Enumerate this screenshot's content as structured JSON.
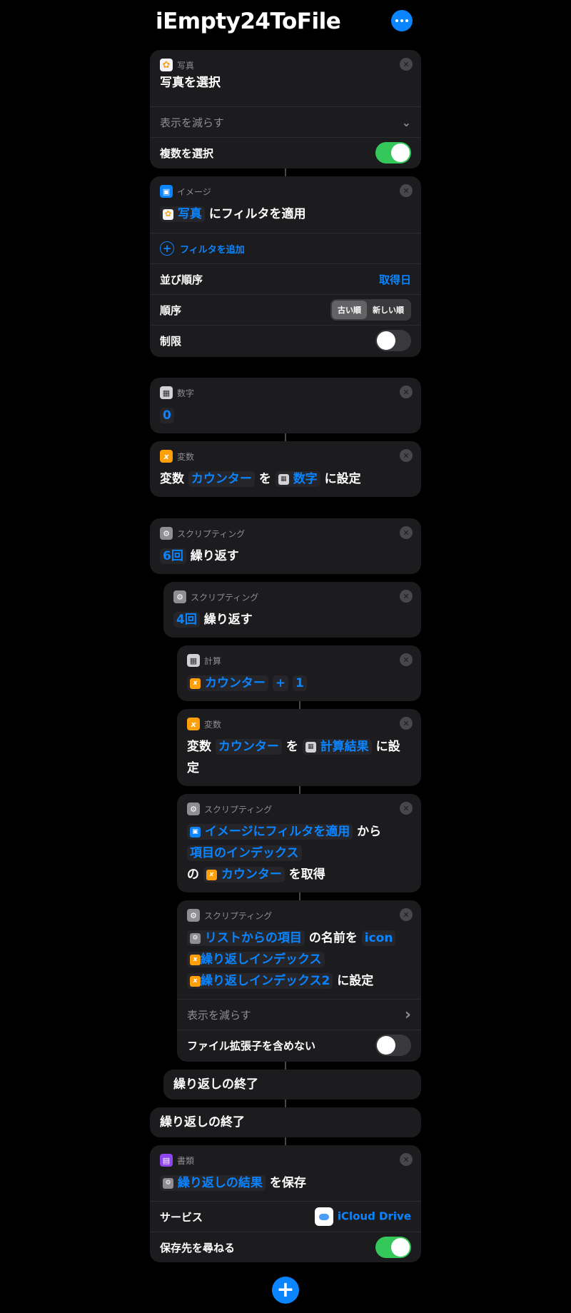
{
  "title": "iEmpty24ToFile",
  "photos_block": {
    "category": "写真",
    "main": "写真を選択",
    "show_less": "表示を減らす",
    "multi_label": "複数を選択"
  },
  "image_block": {
    "category": "イメージ",
    "token": "写真",
    "main_suffix": "にフィルタを適用",
    "add_filter": "フィルタを追加",
    "sort_label": "並び順序",
    "sort_value": "取得日",
    "order_label": "順序",
    "order_options": [
      "古い順",
      "新しい順"
    ],
    "limit_label": "制限"
  },
  "number_block": {
    "category": "数字",
    "value": "0"
  },
  "var_block1": {
    "category": "変数",
    "w1": "変数",
    "token_var": "カウンター",
    "w2": "を",
    "token_value": "数字",
    "w3": "に設定"
  },
  "repeat_outer": {
    "category": "スクリプティング",
    "count": "6回",
    "word": "繰り返す"
  },
  "repeat_inner": {
    "category": "スクリプティング",
    "count": "4回",
    "word": "繰り返す"
  },
  "calc_block": {
    "category": "計算",
    "token_var": "カウンター",
    "op": "+",
    "operand": "1"
  },
  "var_block2": {
    "category": "変数",
    "w1": "変数",
    "token_var": "カウンター",
    "w2": "を",
    "token_value": "計算結果",
    "w3": "に設",
    "w4": "定"
  },
  "get_block": {
    "category": "スクリプティング",
    "token_src": "イメージにフィルタを適用",
    "w1": "から",
    "token_index": "項目のインデックス",
    "w2": "の",
    "token_var": "カウンター",
    "w3": "を取得"
  },
  "rename_block": {
    "category": "スクリプティング",
    "token_item": "リストからの項目",
    "w1": "の名前を",
    "token_name": "icon",
    "token_idx1": "繰り返しインデックス",
    "token_idx2": "繰り返しインデックス2",
    "w2": "に設定",
    "show_less": "表示を減らす",
    "ext_label": "ファイル拡張子を含めない"
  },
  "end_inner": "繰り返しの終了",
  "end_outer": "繰り返しの終了",
  "save_block": {
    "category": "書類",
    "token": "繰り返しの結果",
    "suffix": "を保存",
    "service_label": "サービス",
    "service_value": "iCloud Drive",
    "ask_label": "保存先を尋ねる"
  },
  "icons": {
    "close": "✕",
    "plus": "+",
    "chevron_down": "⌄",
    "chevron_right": "›"
  }
}
